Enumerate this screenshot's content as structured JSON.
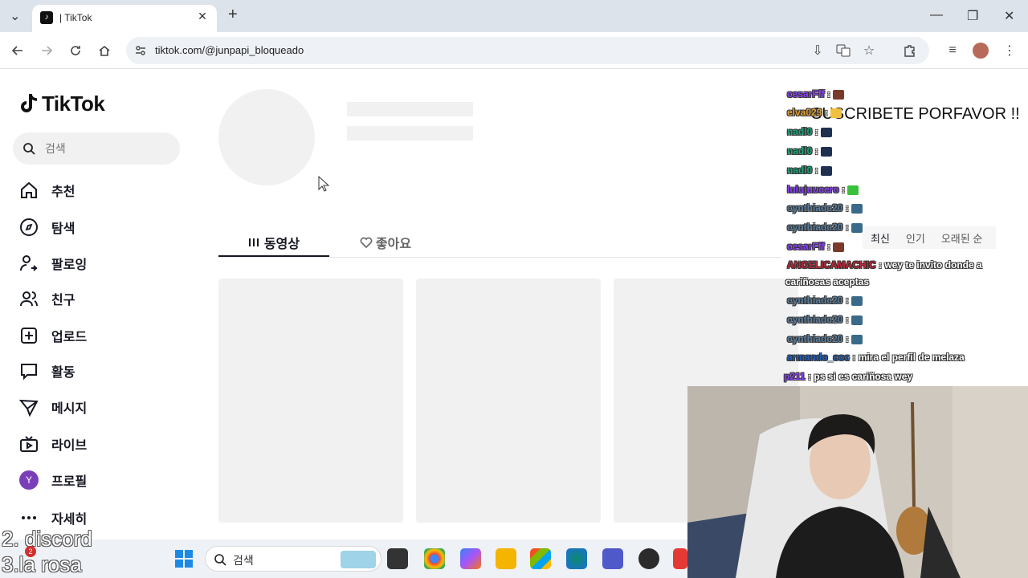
{
  "browser": {
    "tab_title": "| TikTok",
    "url": "tiktok.com/@junpapi_bloqueado"
  },
  "sidebar": {
    "logo_text": "TikTok",
    "search_placeholder": "검색",
    "items": [
      {
        "label": "추천",
        "icon": "home-icon"
      },
      {
        "label": "탐색",
        "icon": "compass-icon"
      },
      {
        "label": "팔로잉",
        "icon": "following-icon"
      },
      {
        "label": "친구",
        "icon": "friends-icon"
      },
      {
        "label": "업로드",
        "icon": "upload-icon"
      },
      {
        "label": "활동",
        "icon": "activity-icon"
      },
      {
        "label": "메시지",
        "icon": "message-icon"
      },
      {
        "label": "라이브",
        "icon": "live-icon"
      },
      {
        "label": "프로필",
        "icon": "avatar"
      },
      {
        "label": "자세히",
        "icon": "more-icon"
      }
    ],
    "profile_initial": "Y"
  },
  "profile": {
    "tabs": [
      {
        "label": "동영상",
        "active": true
      },
      {
        "label": "좋아요",
        "active": false
      }
    ]
  },
  "overlay": {
    "subscribe_text": "SUSCRIBETE PORFAVOR !!",
    "sort_tabs": [
      "최신",
      "인기",
      "오래된 순"
    ],
    "chat": [
      {
        "user": "cesarFff",
        "msg": "",
        "color": "#8a3ffc"
      },
      {
        "user": "elva023",
        "msg": "",
        "color": "#e0a030"
      },
      {
        "user": "nadl0",
        "msg": "",
        "color": "#1aa37a"
      },
      {
        "user": "nadl0",
        "msg": "",
        "color": "#1aa37a"
      },
      {
        "user": "nadl0",
        "msg": "",
        "color": "#1aa37a"
      },
      {
        "user": "lulujuucero",
        "msg": "",
        "color": "#8a3ffc"
      },
      {
        "user": "cynthiadc20",
        "msg": "",
        "color": "#5a7fa0"
      },
      {
        "user": "cynthiadc20",
        "msg": "",
        "color": "#5a7fa0"
      },
      {
        "user": "cesarFff",
        "msg": "",
        "color": "#8a3ffc"
      },
      {
        "user": "ANGELICAMACHIC",
        "msg": "wey te invito donde a",
        "color": "#c0283a"
      },
      {
        "user": "",
        "msg": "cariñosas aceptas",
        "color": "#ffffff"
      },
      {
        "user": "cynthiadc20",
        "msg": "",
        "color": "#5a7fa0"
      },
      {
        "user": "cynthiadc20",
        "msg": "",
        "color": "#5a7fa0"
      },
      {
        "user": "cynthiadc20",
        "msg": "",
        "color": "#5a7fa0"
      },
      {
        "user": "armando_coc",
        "msg": "mira el perfil de melaza",
        "color": "#2060c0"
      },
      {
        "user": "p211",
        "msg": "ps si es cariñosa wey",
        "color": "#8a3ffc"
      }
    ],
    "stream_text": "2. discord\n3.la rosa"
  },
  "taskbar": {
    "search_label": "검색",
    "notif_count": "2"
  }
}
